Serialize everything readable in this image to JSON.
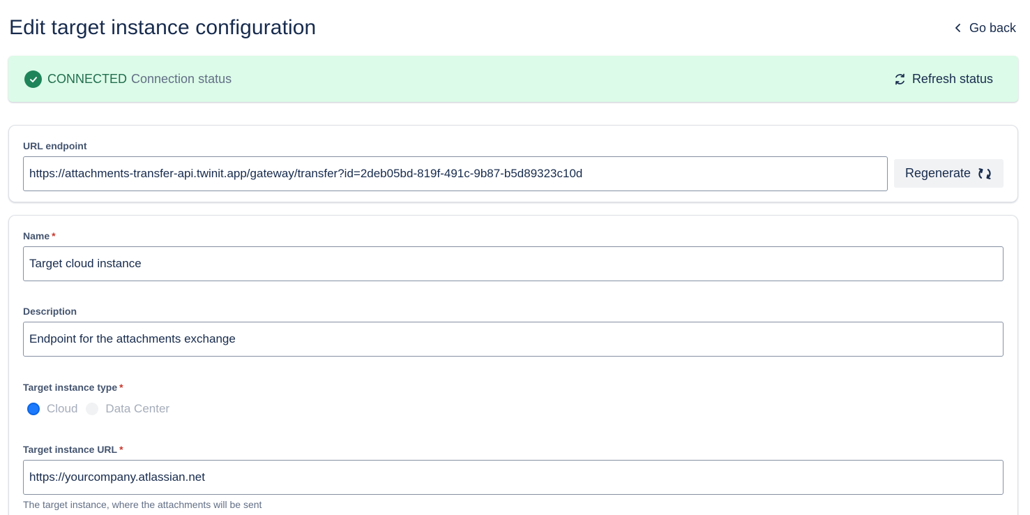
{
  "header": {
    "title": "Edit target instance configuration",
    "go_back_label": "Go back"
  },
  "status": {
    "state": "CONNECTED",
    "description": "Connection status",
    "refresh_label": "Refresh status",
    "color_bg": "#dcfbe8",
    "color_success": "#1f845a"
  },
  "url_endpoint": {
    "label": "URL endpoint",
    "value": "https://attachments-transfer-api.twinit.app/gateway/transfer?id=2deb05bd-819f-491c-9b87-b5d89323c10d",
    "regenerate_label": "Regenerate"
  },
  "form": {
    "required_mark": "*",
    "name": {
      "label": "Name",
      "value": "Target cloud instance"
    },
    "description": {
      "label": "Description",
      "value": "Endpoint for the attachments exchange"
    },
    "instance_type": {
      "label": "Target instance type",
      "options": [
        "Cloud",
        "Data Center"
      ],
      "selected": "Cloud"
    },
    "instance_url": {
      "label": "Target instance URL",
      "value": "https://yourcompany.atlassian.net",
      "helper": "The target instance, where the attachments will be sent"
    }
  },
  "icons": {
    "go_back": "chevron-left-icon",
    "status": "check-circle-icon",
    "refresh": "refresh-icon",
    "regenerate": "refresh-icon"
  },
  "colors": {
    "primary": "#0c66e4",
    "text": "#172b4d",
    "required": "#c9372c"
  }
}
